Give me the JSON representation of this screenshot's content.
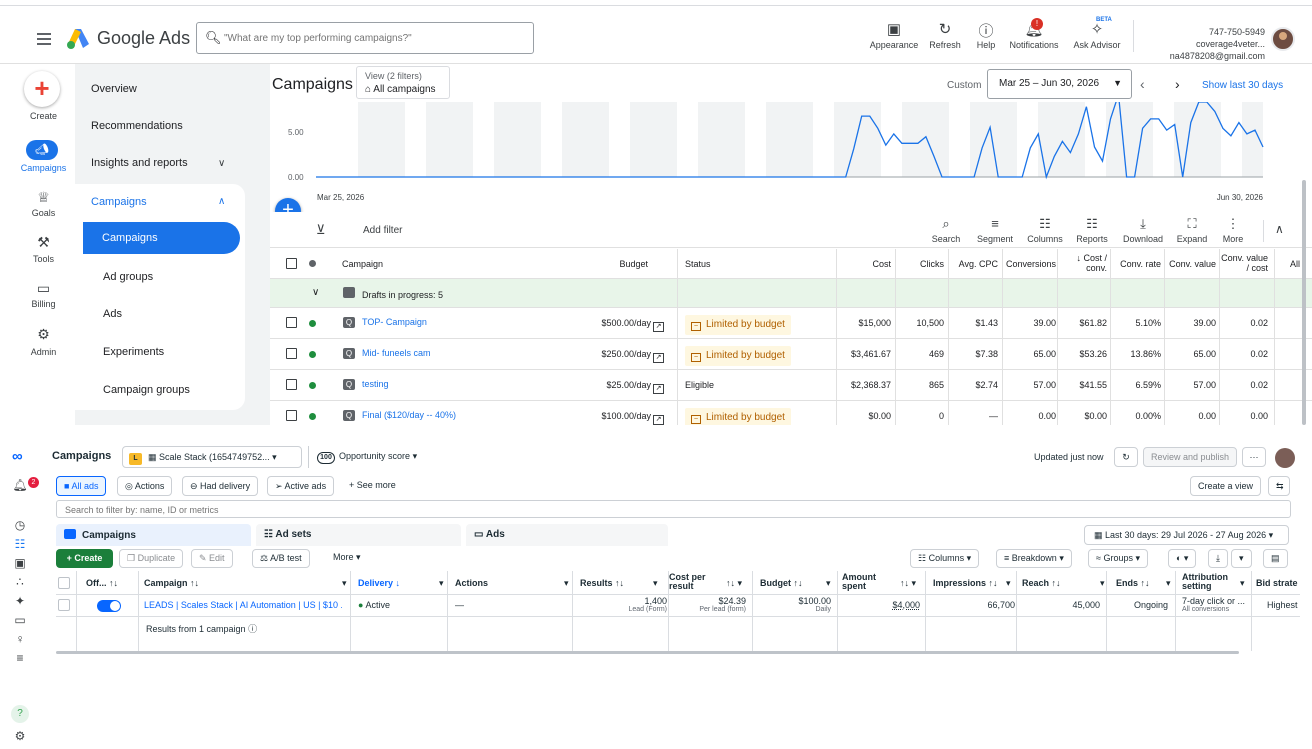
{
  "gads": {
    "app_title": "Google Ads",
    "search_placeholder": "\"What are my top performing campaigns?\"",
    "header_buttons": [
      {
        "icon": "appearance-icon",
        "label": "Appearance"
      },
      {
        "icon": "refresh-icon",
        "label": "Refresh"
      },
      {
        "icon": "help-icon",
        "label": "Help"
      },
      {
        "icon": "bell-icon",
        "label": "Notifications",
        "badge": "!"
      },
      {
        "icon": "advisor-icon",
        "label": "Ask Advisor",
        "tag": "BETA"
      }
    ],
    "account": {
      "line1": "747-750-5949 coverage4veter...",
      "line2": "na4878208@gmail.com"
    },
    "rail": {
      "create": "Create",
      "items": [
        {
          "label": "Campaigns",
          "icon": "campaigns-icon"
        },
        {
          "label": "Goals",
          "icon": "trophy-icon"
        },
        {
          "label": "Tools",
          "icon": "tools-icon"
        },
        {
          "label": "Billing",
          "icon": "billing-icon"
        },
        {
          "label": "Admin",
          "icon": "gear-icon"
        }
      ]
    },
    "nav": {
      "overview": "Overview",
      "recommendations": "Recommendations",
      "insights": "Insights and reports",
      "campaigns_group": "Campaigns",
      "sub": [
        "Campaigns",
        "Ad groups",
        "Ads",
        "Experiments",
        "Campaign groups"
      ]
    },
    "main": {
      "title": "Campaigns",
      "view_line1": "View (2 filters)",
      "view_line2": "All campaigns",
      "custom": "Custom",
      "date_range": "Mar 25 – Jun 30, 2026",
      "show_last": "Show last 30 days"
    },
    "chart_data": {
      "type": "line",
      "y_ticks": [
        "5.00",
        "0.00"
      ],
      "x_start": "Mar 25, 2026",
      "x_end": "Jun 30, 2026",
      "ylim": [
        0,
        8
      ],
      "values": [
        0,
        0,
        0,
        0,
        0,
        0,
        0,
        0,
        0,
        0,
        0,
        0,
        0,
        0,
        0,
        0,
        0,
        0,
        0,
        0,
        0,
        0,
        0,
        0,
        0,
        0,
        0,
        0,
        0,
        0,
        0,
        0,
        0,
        0,
        0,
        0,
        0,
        0,
        0,
        0,
        0,
        0,
        0,
        0,
        0,
        0,
        0,
        0,
        0,
        0,
        0,
        0,
        0,
        0,
        0,
        0,
        0,
        0,
        0,
        0,
        0,
        0,
        0,
        0,
        0,
        0,
        0,
        3,
        6.5,
        6.5,
        5.2,
        3.4,
        4.6,
        3.6,
        3.6,
        3.6,
        4.3,
        2.2,
        0,
        0,
        0,
        0,
        0,
        3.1,
        5.3,
        0,
        0,
        0,
        0,
        3.1,
        4.6,
        0,
        2.2,
        3.8,
        2.6,
        4.6,
        7.5,
        3.2,
        1.7,
        6.2,
        8.8,
        0,
        0,
        5.2,
        6.2,
        6.2,
        5.0,
        5.6,
        0,
        5.8,
        8.0,
        8.0,
        7.0,
        5.2,
        4.4,
        5.8,
        4.6,
        5.0,
        3.2
      ]
    },
    "toolbar": {
      "add_filter": "Add filter",
      "buttons": [
        {
          "icon": "search-icon",
          "label": "Search"
        },
        {
          "icon": "segment-icon",
          "label": "Segment"
        },
        {
          "icon": "columns-icon",
          "label": "Columns"
        },
        {
          "icon": "reports-icon",
          "label": "Reports"
        },
        {
          "icon": "download-icon",
          "label": "Download"
        },
        {
          "icon": "expand-icon",
          "label": "Expand"
        },
        {
          "icon": "more-icon",
          "label": "More"
        }
      ]
    },
    "table": {
      "headers": [
        "Campaign",
        "Budget",
        "Status",
        "Cost",
        "Clicks",
        "Avg. CPC",
        "Conversions",
        "Cost / conv.",
        "Conv. rate",
        "Conv. value",
        "Conv. value / cost",
        "All"
      ],
      "drafts": "Drafts in progress: 5",
      "rows": [
        {
          "name": "TOP- Campaign",
          "budget": "$500.00/day",
          "status": "Limited by budget",
          "limited": true,
          "cost": "$15,000",
          "clicks": "10,500",
          "cpc": "$1.43",
          "conv": "39.00",
          "cost_conv": "$61.82",
          "conv_rate": "5.10%",
          "conv_value": "39.00",
          "value_cost": "0.02"
        },
        {
          "name": "Mid- funeels cam",
          "budget": "$250.00/day",
          "status": "Limited by budget",
          "limited": true,
          "cost": "$3,461.67",
          "clicks": "469",
          "cpc": "$7.38",
          "conv": "65.00",
          "cost_conv": "$53.26",
          "conv_rate": "13.86%",
          "conv_value": "65.00",
          "value_cost": "0.02"
        },
        {
          "name": "testing",
          "budget": "$25.00/day",
          "status": "Eligible",
          "limited": false,
          "cost": "$2,368.37",
          "clicks": "865",
          "cpc": "$2.74",
          "conv": "57.00",
          "cost_conv": "$41.55",
          "conv_rate": "6.59%",
          "conv_value": "57.00",
          "value_cost": "0.02"
        },
        {
          "name": "Final ($120/day -- 40%)",
          "budget": "$100.00/day",
          "status": "Limited by budget",
          "limited": true,
          "cost": "$0.00",
          "clicks": "0",
          "cpc": "—",
          "conv": "0.00",
          "cost_conv": "$0.00",
          "conv_rate": "0.00%",
          "conv_value": "0.00",
          "value_cost": "0.00"
        }
      ]
    }
  },
  "meta": {
    "title": "Campaigns",
    "account_badge": "L",
    "account": "Scale Stack (1654749752...",
    "opportunity_score": "100",
    "opportunity_label": "Opportunity score",
    "updated": "Updated just now",
    "review_publish": "Review and publish",
    "more": "···",
    "filters": [
      "All ads",
      "Actions",
      "Had delivery",
      "Active ads",
      "+  See more"
    ],
    "create_view": "Create a view",
    "search_placeholder": "Search to filter by: name, ID or metrics",
    "tabs": [
      "Campaigns",
      "Ad sets",
      "Ads"
    ],
    "date_range": "Last 30 days: 29 Jul 2026 - 27 Aug 2026",
    "actions": {
      "create": "+ Create",
      "duplicate": "Duplicate",
      "edit": "Edit",
      "ab_test": "A/B test",
      "more": "More",
      "columns": "Columns",
      "breakdown": "Breakdown",
      "groups": "Groups"
    },
    "headers": [
      "Off... ↑↓",
      "Campaign ↑↓",
      "Delivery ↓",
      "Actions",
      "Results ↑↓",
      "Cost per result",
      "Budget ↑↓",
      "Amount spent",
      "Impressions ↑↓",
      "Reach ↑↓",
      "Ends ↑↓",
      "Attribution setting",
      "Bid strate"
    ],
    "row": {
      "campaign": "LEADS | Scales Stack | AI Automation | US | $10 ...",
      "delivery": "Active",
      "actions": "—",
      "results": "1,400",
      "results_sub": "Lead (Form)",
      "cpr": "$24.39",
      "cpr_sub": "Per lead (form)",
      "budget": "$100.00",
      "budget_sub": "Daily",
      "spent": "$4,000",
      "impressions": "66,700",
      "reach": "45,000",
      "ends": "Ongoing",
      "attribution": "7-day click or ...",
      "attribution_sub": "All conversions",
      "bid": "Highest"
    },
    "summary": "Results from 1 campaign"
  }
}
